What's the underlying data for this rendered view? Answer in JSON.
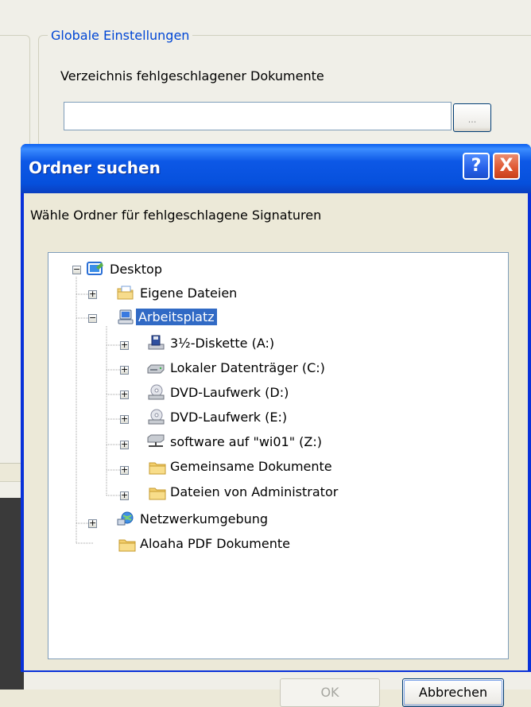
{
  "background": {
    "group_title": "Globale Einstellungen",
    "folder_label": "Verzeichnis fehlgeschlagener Dokumente",
    "folder_value": "",
    "browse_label": "...",
    "status_fragment": ":"
  },
  "dialog": {
    "title": "Ordner suchen",
    "help_label": "?",
    "close_label": "X",
    "instruction": "Wähle Ordner für fehlgeschlagene Signaturen",
    "selected_node": "Arbeitsplatz",
    "tree": [
      {
        "label": "Desktop",
        "icon": "desktop-icon",
        "expander": "minus"
      },
      {
        "label": "Eigene Dateien",
        "icon": "my-documents-icon",
        "expander": "plus"
      },
      {
        "label": "Arbeitsplatz",
        "icon": "my-computer-icon",
        "expander": "minus"
      },
      {
        "label": "3½-Diskette (A:)",
        "icon": "floppy-drive-icon",
        "expander": "plus"
      },
      {
        "label": "Lokaler Datenträger (C:)",
        "icon": "hard-drive-icon",
        "expander": "plus"
      },
      {
        "label": "DVD-Laufwerk (D:)",
        "icon": "dvd-drive-icon",
        "expander": "plus"
      },
      {
        "label": "DVD-Laufwerk (E:)",
        "icon": "dvd-drive-icon",
        "expander": "plus"
      },
      {
        "label": "software auf \"wi01\" (Z:)",
        "icon": "network-drive-icon",
        "expander": "plus"
      },
      {
        "label": "Gemeinsame Dokumente",
        "icon": "folder-icon",
        "expander": "plus"
      },
      {
        "label": "Dateien von Administrator",
        "icon": "folder-icon",
        "expander": "plus"
      },
      {
        "label": "Netzwerkumgebung",
        "icon": "network-places-icon",
        "expander": "plus"
      },
      {
        "label": "Aloaha PDF Dokumente",
        "icon": "folder-icon",
        "expander": "none"
      }
    ],
    "ok_label": "OK",
    "cancel_label": "Abbrechen",
    "ok_enabled": false
  },
  "colors": {
    "titlebar": "#0a5ff0",
    "selection": "#316ac5",
    "group_title": "#0046d5",
    "close_button": "#e05a34"
  }
}
